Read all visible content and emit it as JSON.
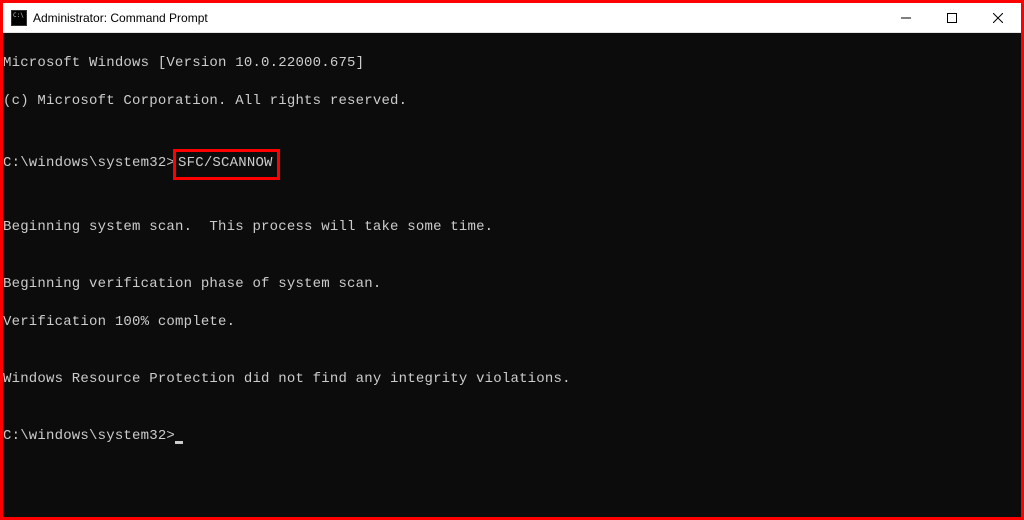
{
  "window": {
    "title": "Administrator: Command Prompt"
  },
  "terminal": {
    "line1": "Microsoft Windows [Version 10.0.22000.675]",
    "line2": "(c) Microsoft Corporation. All rights reserved.",
    "blank1": "",
    "prompt1_path": "C:\\windows\\system32>",
    "prompt1_cmd": "SFC/SCANNOW",
    "blank2": "",
    "line3": "Beginning system scan.  This process will take some time.",
    "blank3": "",
    "line4": "Beginning verification phase of system scan.",
    "line5": "Verification 100% complete.",
    "blank4": "",
    "line6": "Windows Resource Protection did not find any integrity violations.",
    "blank5": "",
    "prompt2_path": "C:\\windows\\system32>"
  },
  "annotation": {
    "highlight_color": "#ff0000"
  }
}
